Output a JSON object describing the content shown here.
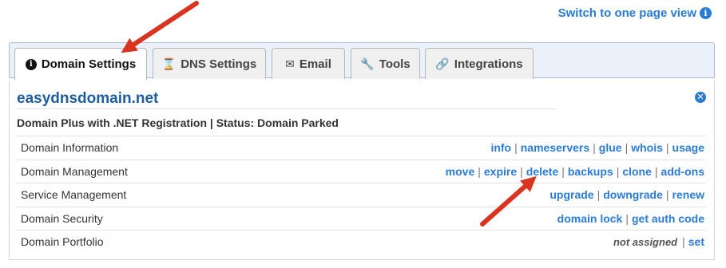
{
  "top_link": {
    "label": "Switch to one page view",
    "icon": "info-circle-icon"
  },
  "tabs": [
    {
      "label": "Domain Settings",
      "icon": "info-circle-icon",
      "active": true
    },
    {
      "label": "DNS Settings",
      "icon": "hourglass-icon",
      "active": false
    },
    {
      "label": "Email",
      "icon": "envelope-icon",
      "active": false
    },
    {
      "label": "Tools",
      "icon": "wrench-icon",
      "active": false
    },
    {
      "label": "Integrations",
      "icon": "link-icon",
      "active": false
    }
  ],
  "panel": {
    "domain": "easydnsdomain.net",
    "subtitle": "Domain Plus with .NET Registration | Status: Domain Parked",
    "rows": [
      {
        "label": "Domain Information",
        "links": [
          "info",
          "nameservers",
          "glue",
          "whois",
          "usage"
        ]
      },
      {
        "label": "Domain Management",
        "links": [
          "move",
          "expire",
          "delete",
          "backups",
          "clone",
          "add-ons"
        ]
      },
      {
        "label": "Service Management",
        "links": [
          "upgrade",
          "downgrade",
          "renew"
        ]
      },
      {
        "label": "Domain Security",
        "links": [
          "domain lock",
          "get auth code"
        ]
      },
      {
        "label": "Domain Portfolio",
        "note": "not assigned",
        "links": [
          "set"
        ]
      }
    ]
  },
  "colors": {
    "link": "#2a7bd4",
    "title": "#1f5e9e",
    "arrow": "#d9341f"
  }
}
